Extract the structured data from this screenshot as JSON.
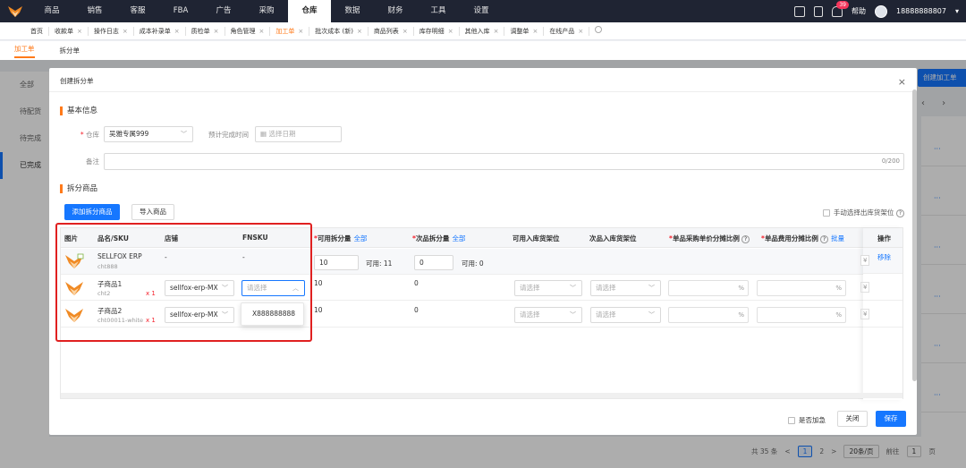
{
  "top_nav": {
    "items": [
      "商品",
      "销售",
      "客服",
      "FBA",
      "广告",
      "采购",
      "仓库",
      "数据",
      "财务",
      "工具",
      "设置"
    ],
    "active": "仓库",
    "badge_count": "39",
    "help_label": "帮助",
    "user_phone": "18888888807"
  },
  "tabs": [
    {
      "label": "首页"
    },
    {
      "label": "收款单"
    },
    {
      "label": "操作日志"
    },
    {
      "label": "成本补录单"
    },
    {
      "label": "质检单"
    },
    {
      "label": "角色管理"
    },
    {
      "label": "加工单"
    },
    {
      "label": "批次成本 (新)"
    },
    {
      "label": "商品列表"
    },
    {
      "label": "库存明细"
    },
    {
      "label": "其他入库"
    },
    {
      "label": "调整单"
    },
    {
      "label": "在线产品"
    }
  ],
  "tab_close": "×",
  "active_tab": "加工单",
  "sub_tabs": [
    "加工单",
    "拆分单"
  ],
  "sidebar": {
    "items": [
      "全部",
      "待配货",
      "待完成",
      "已完成"
    ],
    "active": "已完成"
  },
  "background": {
    "create_button": "创建加工单",
    "pager": {
      "total": "共 35 条",
      "prev": "<",
      "pages": [
        "1",
        "2"
      ],
      "next": ">",
      "page_size": "20条/页",
      "goto_label": "前往",
      "goto_value": "1",
      "page_unit": "页"
    }
  },
  "modal": {
    "title": "创建拆分单",
    "close": "×",
    "basic_section": "基本信息",
    "warehouse_label": "仓库",
    "warehouse_value": "吴雅专属999",
    "finish_time_label": "预计完成时间",
    "finish_time_placeholder": "选择日期",
    "remark_label": "备注",
    "remark_counter": "0/200",
    "split_section": "拆分商品",
    "add_button": "添加拆分商品",
    "import_button": "导入商品",
    "manual_select_label": "手动选择出库货架位",
    "urgent_label": "是否加急",
    "close_button": "关闭",
    "save_button": "保存"
  },
  "table": {
    "headers": {
      "image": "图片",
      "name_sku": "品名/SKU",
      "shop": "店铺",
      "fnsku": "FNSKU",
      "available_split": "可用拆分量",
      "defective_split": "次品拆分量",
      "available_shelf": "可用入库货架位",
      "defective_shelf": "次品入库货架位",
      "unit_price_ratio": "单品采购单价分摊比例",
      "unit_fee_ratio": "单品费用分摊比例",
      "actions": "操作",
      "all_link": "全部",
      "batch_link": "批量",
      "help_mark": "?"
    },
    "parent": {
      "name": "SELLFOX ERP",
      "sku": "cht888",
      "shop": "-",
      "fnsku": "-",
      "available_split": "10",
      "available_note": "可用: 11",
      "defective_split": "0",
      "defective_note": "可用: 0",
      "action": "移除",
      "currency": "¥"
    },
    "children": [
      {
        "name": "子商品1",
        "sku": "cht2",
        "qty": "x 1",
        "shop": "sellfox-erp-MX",
        "fnsku_placeholder": "请选择",
        "available_split": "10",
        "defective_split": "0",
        "available_shelf_placeholder": "请选择",
        "defective_shelf_placeholder": "请选择",
        "pct": "%",
        "currency": "¥"
      },
      {
        "name": "子商品2",
        "sku": "cht00011-white",
        "qty": "x 1",
        "shop": "sellfox-erp-MX",
        "available_split": "10",
        "defective_split": "0",
        "available_shelf_placeholder": "请选择",
        "defective_shelf_placeholder": "请选择",
        "pct": "%",
        "currency": "¥"
      }
    ],
    "fnsku_dropdown_option": "X888888888"
  },
  "colors": {
    "accent_orange": "#ff7a1a",
    "primary_blue": "#1677ff",
    "highlight_red": "#e02020",
    "nav_dark": "#1f2433"
  }
}
